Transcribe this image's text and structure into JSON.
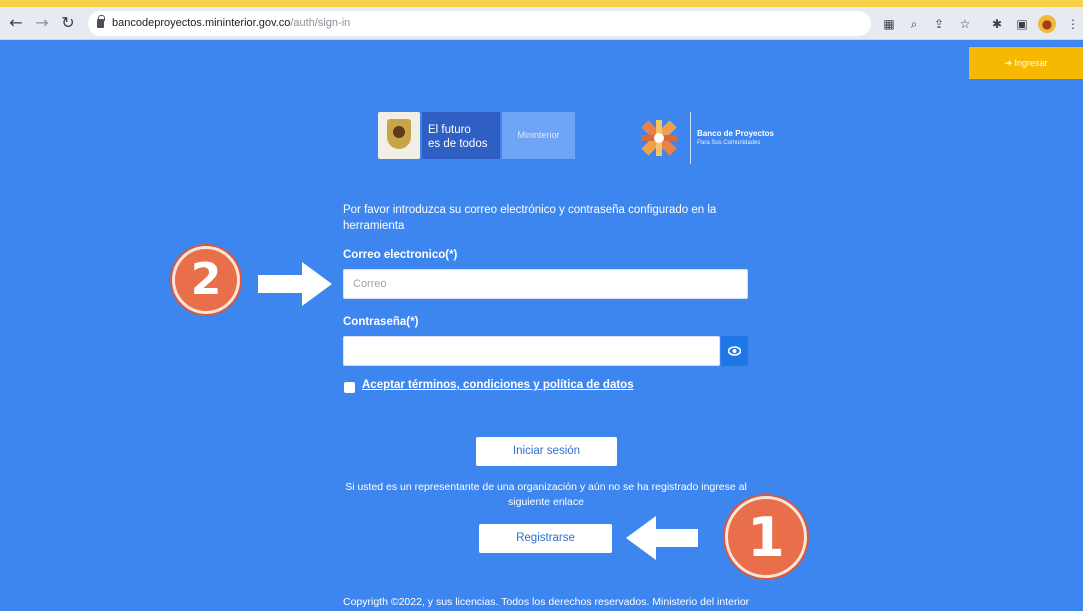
{
  "browser": {
    "url_host": "bancodeproyectos.mininterior.gov.co",
    "url_path": "/auth/sign-in"
  },
  "header": {
    "enter_button_label": "Ingresar"
  },
  "logos": {
    "gov_slogan_line1": "El futuro",
    "gov_slogan_line2": "es de todos",
    "gov_ministry": "Mininterior",
    "banco_title": "Banco de Proyectos",
    "banco_subtitle": "Para Sus Comunidades"
  },
  "form": {
    "intro": "Por favor introduzca su correo electrónico y contraseña configurado en la herramienta",
    "email_label": "Correo electronico(*)",
    "email_placeholder": "Correo",
    "password_label": "Contraseña(*)",
    "terms_label": "Aceptar términos, condiciones y política de datos",
    "login_button": "Iniciar sesión",
    "register_note": "Si usted es un representante de una organización y aún no se ha registrado ingrese al siguiente enlace",
    "register_button": "Registrarse"
  },
  "footer": {
    "copyright": "Copyrigth ©2022, y sus licencias. Todos los derechos reservados. Ministerio del interior"
  },
  "annotations": {
    "step_1": "1",
    "step_2": "2"
  },
  "colors": {
    "page_background": "#3d86f0",
    "accent_yellow": "#f6b800",
    "badge_orange": "#e96e4a",
    "eye_button_blue": "#1f77e6"
  }
}
